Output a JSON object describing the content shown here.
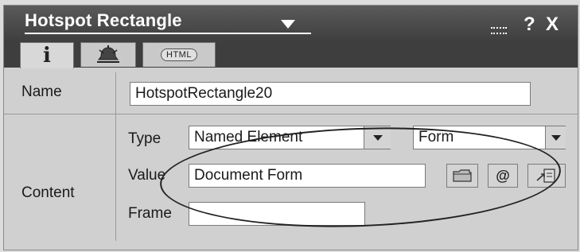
{
  "window": {
    "title": "Hotspot Rectangle",
    "help_label": "?",
    "close_label": "X"
  },
  "tabs": [
    {
      "label": "i",
      "active": true
    },
    {
      "label": "",
      "icon": "bell-icon"
    },
    {
      "label": "HTML"
    }
  ],
  "name_row": {
    "label": "Name",
    "value": "HotspotRectangle20"
  },
  "content_row": {
    "label": "Content",
    "type": {
      "label": "Type",
      "value": "Named Element",
      "second_value": "Form"
    },
    "value": {
      "label": "Value",
      "value": "Document Form",
      "at_label": "@"
    },
    "frame": {
      "label": "Frame",
      "value": ""
    }
  },
  "colors": {
    "titlebar": "#3e3e3e",
    "panel": "#d0d0d0"
  }
}
